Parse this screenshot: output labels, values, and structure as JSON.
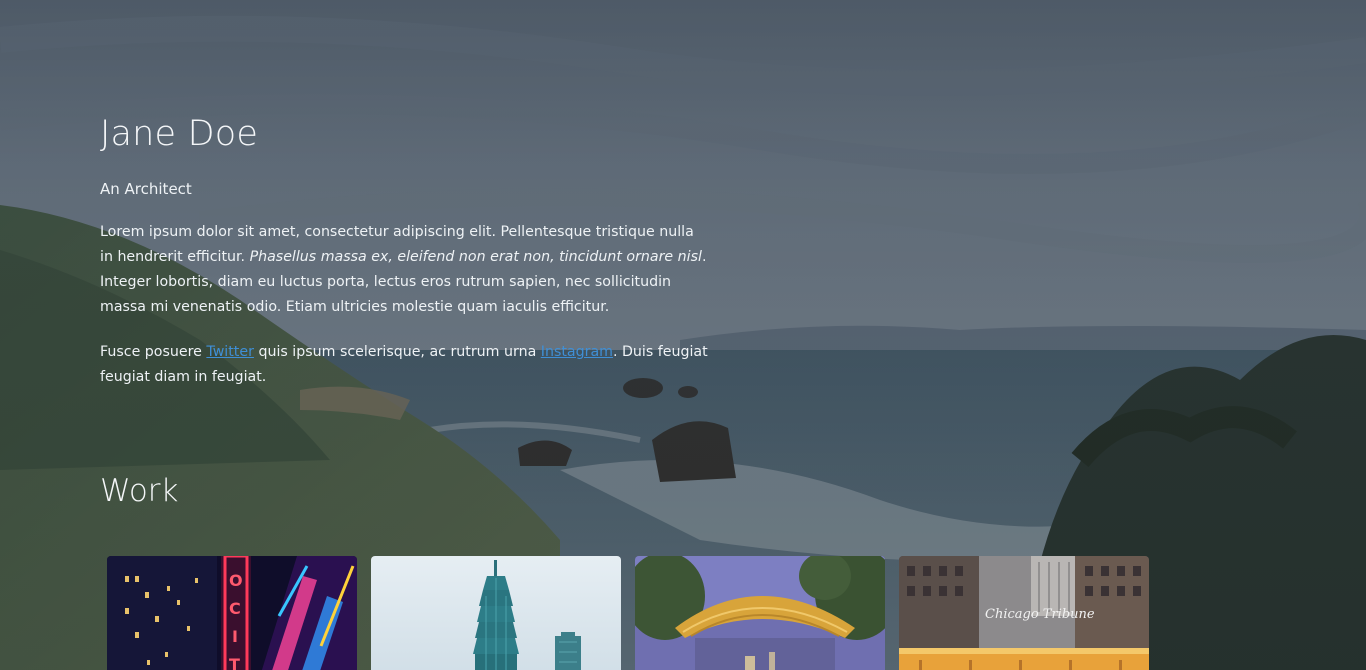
{
  "hero": {
    "name": "Jane Doe",
    "tagline": "An Architect",
    "bio_part1": "Lorem ipsum dolor sit amet, consectetur adipiscing elit. Pellentesque tristique nulla in hendrerit efficitur. ",
    "bio_italic": "Phasellus massa ex, eleifend non erat non, tincidunt ornare nisl",
    "bio_part2": ". Integer lobortis, diam eu luctus porta, lectus eros rutrum sapien, nec sollicitudin massa mi venenatis odio. Etiam ultricies molestie quam iaculis efficitur.",
    "social_part1": "Fusce posuere ",
    "twitter_label": "Twitter",
    "social_part2": " quis ipsum scelerisque, ac rutrum urna ",
    "instagram_label": "Instagram",
    "social_part3": ". Duis feugiat feugiat diam in feugiat."
  },
  "work": {
    "title": "Work",
    "items": [
      {
        "icon": "radio-city-neon-image"
      },
      {
        "icon": "taipei-101-tower-image"
      },
      {
        "icon": "canopy-pavilion-image"
      },
      {
        "icon": "chicago-tribune-building-image",
        "sign_text": "Chicago Tribune"
      }
    ]
  },
  "colors": {
    "link": "#3f8fd6",
    "text": "#eef2f5"
  }
}
